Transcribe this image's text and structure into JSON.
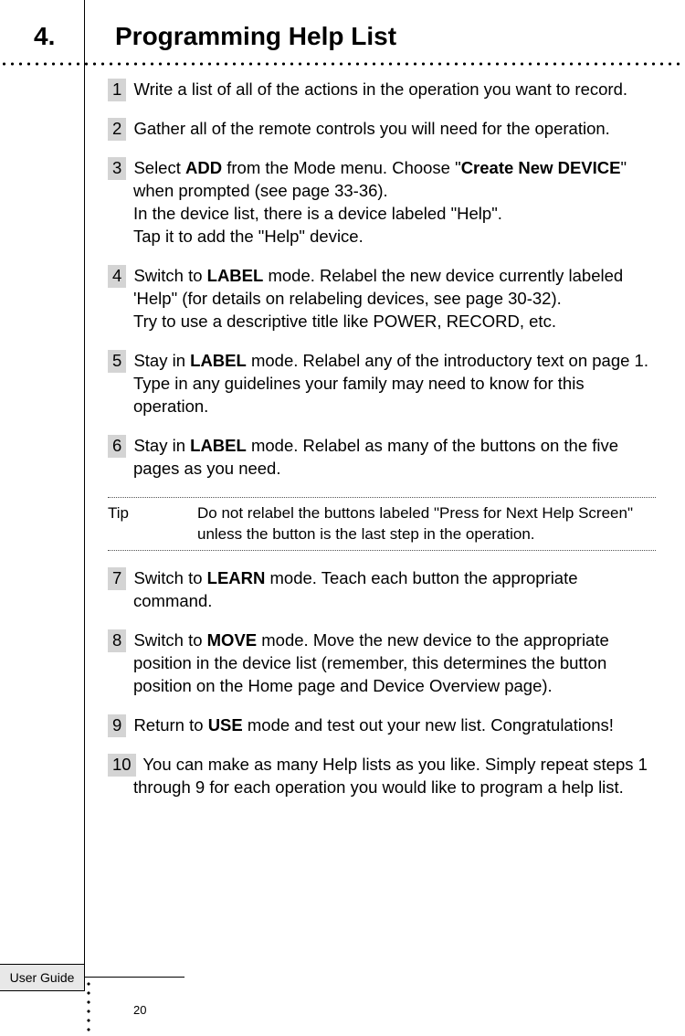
{
  "section": {
    "number": "4.",
    "title": "Programming Help List"
  },
  "steps": [
    {
      "num": "1",
      "parts": [
        {
          "t": "Write a list of all of the actions in the operation you want to record."
        }
      ]
    },
    {
      "num": "2",
      "parts": [
        {
          "t": "Gather all of the remote controls you will need for the operation."
        }
      ]
    },
    {
      "num": "3",
      "parts": [
        {
          "t": "Select "
        },
        {
          "t": "ADD",
          "b": true
        },
        {
          "t": " from the Mode menu. Choose \""
        },
        {
          "t": "Create New DEVICE",
          "b": true
        },
        {
          "t": "\" when prompted (see page 33-36)."
        }
      ],
      "extras": [
        "In the device list, there is a device labeled \"Help\".",
        "Tap it to add the \"Help\" device."
      ]
    },
    {
      "num": "4",
      "parts": [
        {
          "t": "Switch to "
        },
        {
          "t": "LABEL",
          "b": true
        },
        {
          "t": " mode. Relabel the new device currently labeled 'Help\" (for details on relabeling devices, see page 30-32)."
        }
      ],
      "extras": [
        "Try to use a descriptive title like POWER, RECORD, etc."
      ]
    },
    {
      "num": "5",
      "parts": [
        {
          "t": "Stay in "
        },
        {
          "t": "LABEL",
          "b": true
        },
        {
          "t": " mode. Relabel any of the introductory text on page 1. Type in any guidelines your family may need to know for this operation."
        }
      ]
    },
    {
      "num": "6",
      "parts": [
        {
          "t": "Stay in "
        },
        {
          "t": "LABEL",
          "b": true
        },
        {
          "t": " mode. Relabel as many of the buttons on the five pages as you need."
        }
      ]
    }
  ],
  "tip": {
    "label": "Tip",
    "text": "Do not relabel the buttons labeled \"Press for Next Help Screen\" unless the button is the last step in the operation."
  },
  "steps2": [
    {
      "num": "7",
      "parts": [
        {
          "t": "Switch to "
        },
        {
          "t": "LEARN",
          "b": true
        },
        {
          "t": " mode. Teach each button the appropriate command."
        }
      ]
    },
    {
      "num": "8",
      "parts": [
        {
          "t": "Switch to "
        },
        {
          "t": "MOVE",
          "b": true
        },
        {
          "t": " mode. Move the new device to the appropriate position in the device list (remember, this determines the button position on the Home page and Device Overview page)."
        }
      ]
    },
    {
      "num": "9",
      "parts": [
        {
          "t": "Return to "
        },
        {
          "t": "USE",
          "b": true
        },
        {
          "t": " mode and test out your new list. Congratulations!"
        }
      ]
    },
    {
      "num": "10",
      "parts": [
        {
          "t": "You can make as many Help lists as you like. Simply repeat steps 1 through 9 for each operation you would like to program a help list."
        }
      ]
    }
  ],
  "footer": {
    "tab": "User Guide",
    "page": "20"
  }
}
